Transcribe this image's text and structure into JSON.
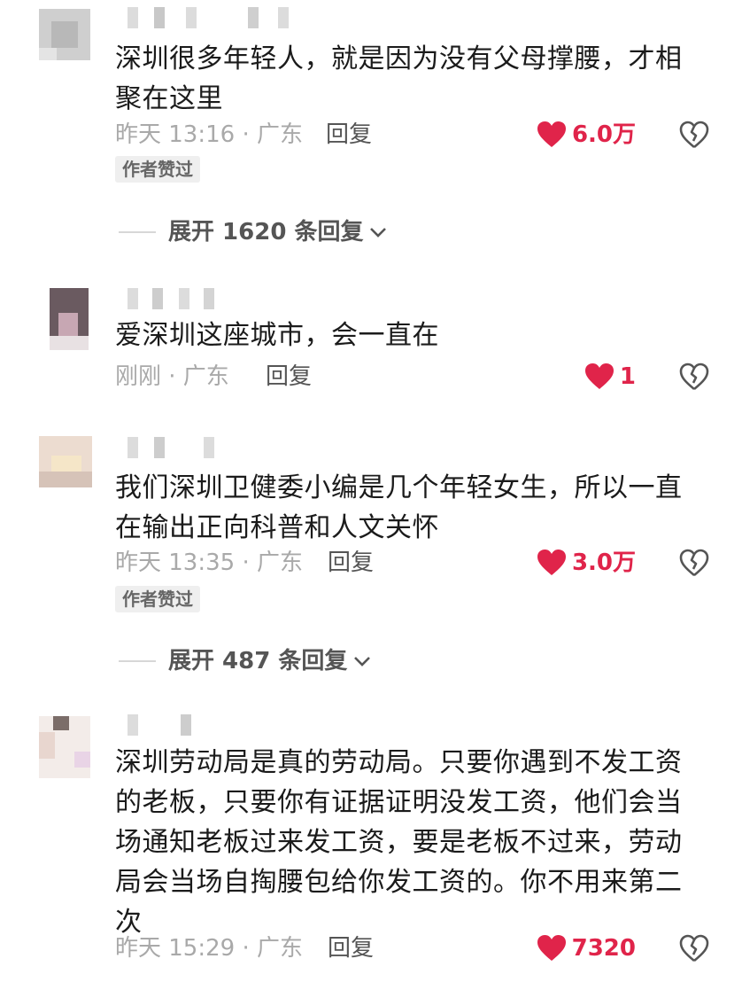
{
  "comments": [
    {
      "text": "深圳很多年轻人，就是因为没有父母撑腰，才相聚在这里",
      "meta": "昨天 13:16 · 广东",
      "reply_label": "回复",
      "likes": "6.0万",
      "badge": "作者赞过",
      "expand_label": "展开 1620 条回复"
    },
    {
      "text": "爱深圳这座城市，会一直在",
      "meta": "刚刚 · 广东",
      "reply_label": "回复",
      "likes": "1"
    },
    {
      "text": "我们深圳卫健委小编是几个年轻女生，所以一直在输出正向科普和人文关怀",
      "meta": "昨天 13:35 · 广东",
      "reply_label": "回复",
      "likes": "3.0万",
      "badge": "作者赞过",
      "expand_label": "展开 487 条回复"
    },
    {
      "text": "深圳劳动局是真的劳动局。只要你遇到不发工资的老板，只要你有证据证明没发工资，他们会当场通知老板过来发工资，要是老板不过来，劳动局会当场自掏腰包给你发工资的。你不用来第二次",
      "meta": "昨天 15:29 · 广东",
      "reply_label": "回复",
      "likes": "7320"
    }
  ],
  "colors": {
    "like_red": "#e0244a",
    "meta_gray": "#a9a9a9",
    "badge_bg": "#efefef"
  },
  "icons": [
    "heart-icon",
    "broken-heart-icon",
    "chevron-down-icon"
  ]
}
